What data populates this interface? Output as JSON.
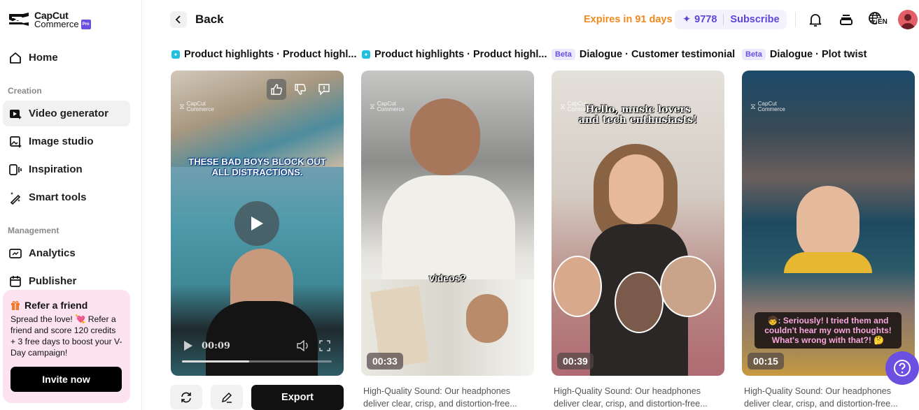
{
  "app": {
    "brand_line1": "CapCut",
    "brand_line2": "Commerce",
    "badge": "Pro"
  },
  "sidebar": {
    "home": "Home",
    "section_creation": "Creation",
    "creation_items": [
      {
        "label": "Video generator",
        "icon": "video-spark-icon",
        "active": true
      },
      {
        "label": "Image studio",
        "icon": "image-spark-icon",
        "active": false
      },
      {
        "label": "Inspiration",
        "icon": "inspiration-icon",
        "active": false
      },
      {
        "label": "Smart tools",
        "icon": "magic-wand-icon",
        "active": false
      }
    ],
    "section_management": "Management",
    "management_items": [
      {
        "label": "Analytics",
        "icon": "analytics-icon"
      },
      {
        "label": "Publisher",
        "icon": "calendar-icon"
      }
    ],
    "refer": {
      "title": "Refer a friend",
      "body": "Spread the love! 💘 Refer a friend and score 120 credits + 3 free days to boost your V-Day campaign!",
      "button": "Invite now"
    }
  },
  "header": {
    "back_label": "Back",
    "expires": "Expires in 91 days",
    "credits": "9778",
    "subscribe": "Subscribe",
    "language": "EN"
  },
  "cards": [
    {
      "tag": "",
      "title": "Product highlights · Product highl...",
      "caption": "THESE BAD BOYS BLOCK OUT ALL DISTRACTIONS.",
      "player_time": "00:09",
      "progress": 0.45,
      "description": ""
    },
    {
      "tag": "",
      "title": "Product highlights · Product highl...",
      "caption": "videos?",
      "duration": "00:33",
      "description": "High-Quality Sound: Our headphones deliver clear, crisp, and distortion-free..."
    },
    {
      "tag": "Beta",
      "title": "Dialogue · Customer testimonial",
      "caption": "Hello, music lovers and tech enthusiasts!",
      "duration": "00:39",
      "description": "High-Quality Sound: Our headphones deliver clear, crisp, and distortion-free..."
    },
    {
      "tag": "Beta",
      "title": "Dialogue · Plot twist",
      "caption": "🧒: Seriously! I tried them and couldn't hear my own thoughts! What's wrong with that?! 🤔",
      "duration": "00:15",
      "description": "High-Quality Sound: Our headphones deliver clear, crisp, and distortion-free..."
    }
  ],
  "actions": {
    "export": "Export"
  },
  "watermark": {
    "l1": "CapCut",
    "l2": "Commerce"
  }
}
